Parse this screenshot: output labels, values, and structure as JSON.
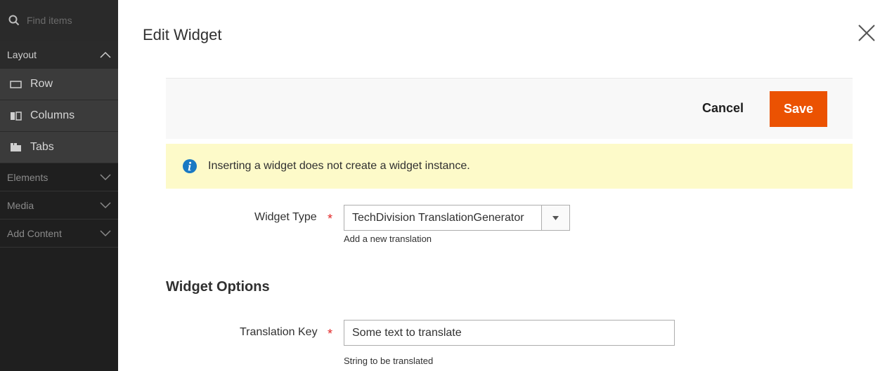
{
  "sidebar": {
    "search": {
      "placeholder": "Find items",
      "icon": "search-icon"
    },
    "groups": [
      {
        "label": "Layout",
        "expanded": true,
        "items": [
          {
            "label": "Row",
            "icon": "row-icon"
          },
          {
            "label": "Columns",
            "icon": "columns-icon"
          },
          {
            "label": "Tabs",
            "icon": "tabs-icon"
          }
        ]
      },
      {
        "label": "Elements",
        "expanded": false
      },
      {
        "label": "Media",
        "expanded": false
      },
      {
        "label": "Add Content",
        "expanded": false
      }
    ]
  },
  "modal": {
    "title": "Edit Widget",
    "close_icon": "close-icon"
  },
  "actions": {
    "cancel_label": "Cancel",
    "save_label": "Save",
    "save_color": "#eb5202"
  },
  "notice": {
    "icon": "info-icon",
    "message": "Inserting a widget does not create a widget instance."
  },
  "form": {
    "widget_type": {
      "label": "Widget Type",
      "required_mark": "*",
      "value": "TechDivision TranslationGenerator",
      "note": "Add a new translation"
    },
    "options_heading": "Widget Options",
    "translation_key": {
      "label": "Translation Key",
      "required_mark": "*",
      "value": "Some text to translate",
      "note": "String to be translated"
    }
  },
  "colors": {
    "sidebar_bg": "#1f1f1f",
    "accent": "#eb5202",
    "notice_bg": "#fdfac9",
    "info_icon": "#1979c3",
    "required": "#e22626"
  }
}
